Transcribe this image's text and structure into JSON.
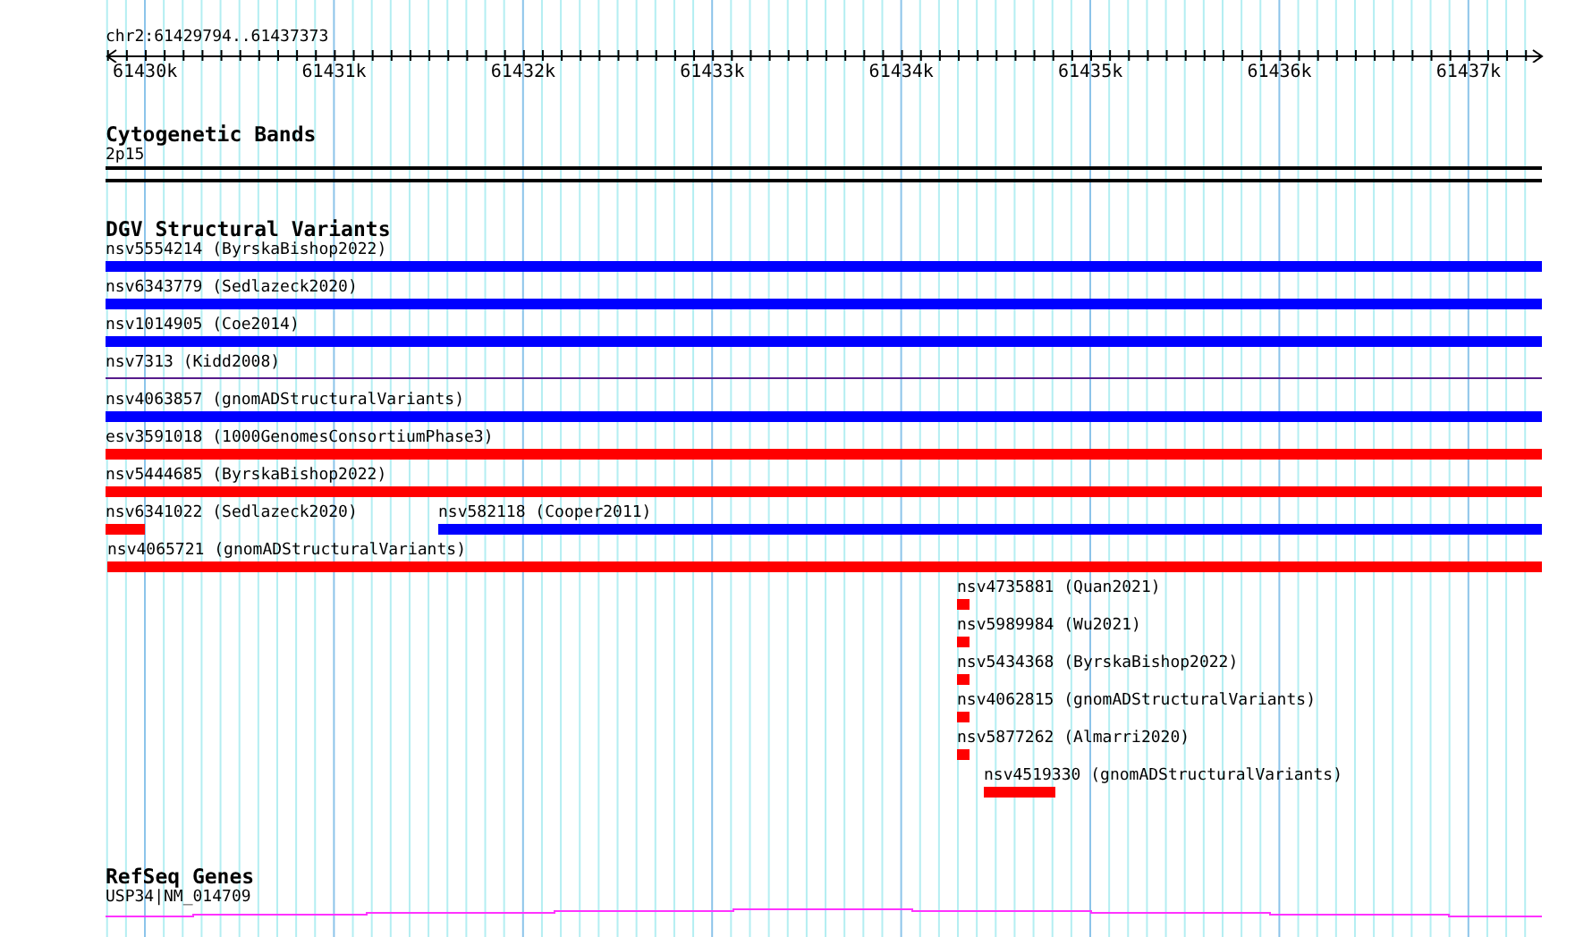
{
  "ruler": {
    "location": "chr2:61429794..61437373",
    "ticks": [
      "61430k",
      "61431k",
      "61432k",
      "61433k",
      "61434k",
      "61435k",
      "61436k",
      "61437k"
    ]
  },
  "cytogenetic_bands": {
    "title": "Cytogenetic Bands",
    "band": "2p15"
  },
  "dgv_structural_variants": {
    "title": "DGV Structural Variants",
    "rows": [
      {
        "features": [
          {
            "label": "nsv5554214 (ByrskaBishop2022)",
            "color": "#0000ff",
            "kind": "bar"
          }
        ]
      },
      {
        "features": [
          {
            "label": "nsv6343779 (Sedlazeck2020)",
            "color": "#0000ff",
            "kind": "bar"
          }
        ]
      },
      {
        "features": [
          {
            "label": "nsv1014905 (Coe2014)",
            "color": "#0000ff",
            "kind": "bar"
          }
        ]
      },
      {
        "features": [
          {
            "label": "nsv7313 (Kidd2008)",
            "color": "#551a8b",
            "kind": "line"
          }
        ]
      },
      {
        "features": [
          {
            "label": "nsv4063857 (gnomADStructuralVariants)",
            "color": "#0000ff",
            "kind": "bar"
          }
        ]
      },
      {
        "features": [
          {
            "label": "esv3591018 (1000GenomesConsortiumPhase3)",
            "color": "#ff0000",
            "kind": "bar"
          }
        ]
      },
      {
        "features": [
          {
            "label": "nsv5444685 (ByrskaBishop2022)",
            "color": "#ff0000",
            "kind": "bar"
          }
        ]
      },
      {
        "features": [
          {
            "label": "nsv6341022 (Sedlazeck2020)",
            "color": "#ff0000",
            "kind": "bar"
          },
          {
            "label": "nsv582118 (Cooper2011)",
            "color": "#0000ff",
            "kind": "bar"
          }
        ]
      },
      {
        "features": [
          {
            "label": "nsv4065721 (gnomADStructuralVariants)",
            "color": "#ff0000",
            "kind": "bar"
          }
        ]
      },
      {
        "features": [
          {
            "label": "nsv4735881 (Quan2021)",
            "color": "#ff0000",
            "kind": "bar"
          }
        ]
      },
      {
        "features": [
          {
            "label": "nsv5989984 (Wu2021)",
            "color": "#ff0000",
            "kind": "bar"
          }
        ]
      },
      {
        "features": [
          {
            "label": "nsv5434368 (ByrskaBishop2022)",
            "color": "#ff0000",
            "kind": "bar"
          }
        ]
      },
      {
        "features": [
          {
            "label": "nsv4062815 (gnomADStructuralVariants)",
            "color": "#ff0000",
            "kind": "bar"
          }
        ]
      },
      {
        "features": [
          {
            "label": "nsv5877262 (Almarri2020)",
            "color": "#ff0000",
            "kind": "bar"
          }
        ]
      },
      {
        "features": [
          {
            "label": "nsv4519330 (gnomADStructuralVariants)",
            "color": "#ff0000",
            "kind": "bar"
          }
        ]
      }
    ]
  },
  "refseq_genes": {
    "title": "RefSeq Genes",
    "genes": [
      {
        "label": "USP34|NM_014709"
      }
    ]
  }
}
